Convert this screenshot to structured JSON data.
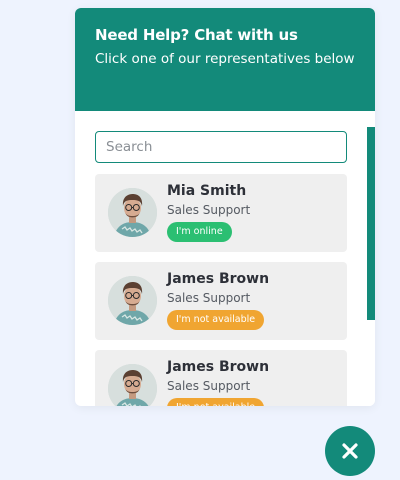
{
  "header": {
    "title": "Need Help? Chat with us",
    "subtitle": "Click one of our representatives below"
  },
  "search": {
    "placeholder": "Search",
    "value": ""
  },
  "representatives": [
    {
      "name": "Mia Smith",
      "role": "Sales Support",
      "status": "I'm online",
      "status_type": "online"
    },
    {
      "name": "James Brown",
      "role": "Sales Support",
      "status": "I'm not available",
      "status_type": "away"
    },
    {
      "name": "James Brown",
      "role": "Sales Support",
      "status": "I'm not available",
      "status_type": "away"
    }
  ],
  "colors": {
    "brand": "#138a7a",
    "online": "#2bbf72",
    "away": "#f0a531",
    "card_bg": "#efefef",
    "page_bg": "#eef3fe"
  },
  "icons": {
    "close": "close-icon"
  }
}
